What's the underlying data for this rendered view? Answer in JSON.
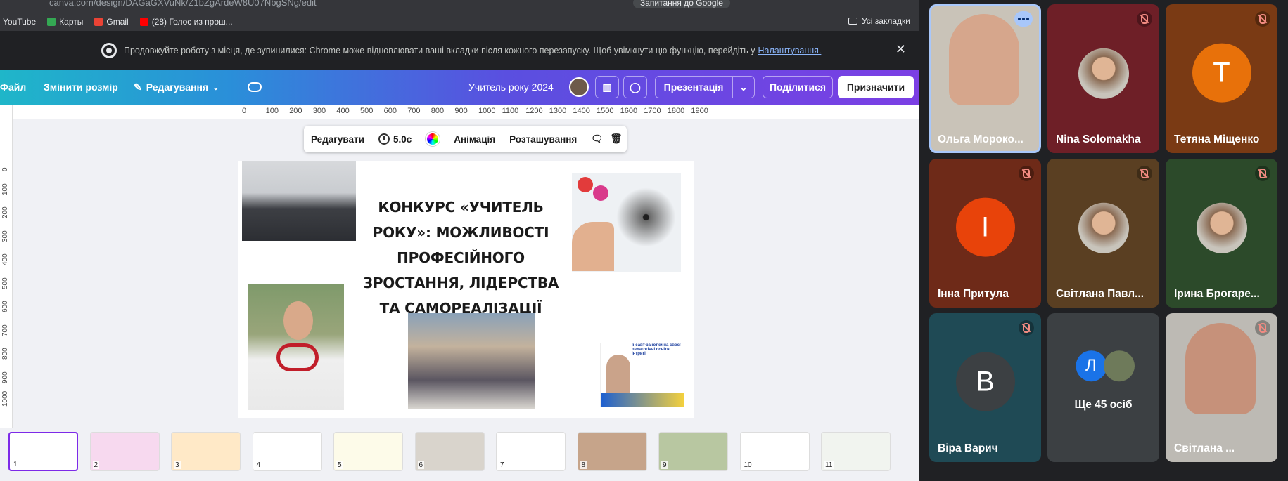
{
  "browser": {
    "url": "canva.com/design/DAGaGXVuNk/Z1bZgArdeW8U07NbgSNg/edit",
    "google_translate": "Запитання до Google",
    "bookmarks": [
      {
        "label": "YouTube",
        "color": "#ff0000"
      },
      {
        "label": "Карты",
        "color": "#34a853"
      },
      {
        "label": "Gmail",
        "color": "#ea4335"
      },
      {
        "label": "(28) Голос из прош...",
        "color": "#ff0000"
      }
    ],
    "all_bookmarks": "Усі закладки",
    "notice_text": "Продовжуйте роботу з місця, де зупинилися: Chrome може відновлювати ваші вкладки після кожного перезапуску. Щоб увімкнути цю функцію, перейдіть у",
    "notice_link": "Налаштування."
  },
  "canva": {
    "file": "Файл",
    "resize": "Змінити розмір",
    "editing": "Редагування",
    "doc_title": "Учитель року 2024",
    "present": "Презентація",
    "share": "Поділитися",
    "assign": "Призначити",
    "ruler_ticks": [
      "0",
      "100",
      "200",
      "300",
      "400",
      "500",
      "600",
      "700",
      "800",
      "900",
      "1000",
      "1100",
      "1200",
      "1300",
      "1400",
      "1500",
      "1600",
      "1700",
      "1800",
      "1900"
    ],
    "vruler_ticks": [
      "0",
      "100",
      "200",
      "300",
      "400",
      "500",
      "600",
      "700",
      "800",
      "900",
      "1000"
    ],
    "floating_toolbar": {
      "edit": "Редагувати",
      "duration": "5.0с",
      "animation": "Анімація",
      "position": "Розташування"
    },
    "slide": {
      "title": "КОНКУРС «УЧИТЕЛЬ РОКУ»: МОЖЛИВОСТІ ПРОФЕСІЙНОГО ЗРОСТАННЯ, ЛІДЕРСТВА ТА САМОРЕАЛІЗАЦІЇ ПЕДАГОГА",
      "infographic_title": "Інсайт-занотки на своєї педагогічні освітні інтригі"
    },
    "thumbnails": [
      "1",
      "2",
      "3",
      "4",
      "5",
      "6",
      "7",
      "8",
      "9",
      "10",
      "11"
    ]
  },
  "meet": {
    "participants": [
      {
        "name": "Ольга Мороко...",
        "bg": "#c9c3b8",
        "initial": "",
        "type": "video",
        "speaking": true
      },
      {
        "name": "Nina Solomakha",
        "bg": "#6e1f27",
        "initial": "",
        "type": "photo",
        "muted": true
      },
      {
        "name": "Тетяна Міщенко",
        "bg": "#7a3a14",
        "initial": "Т",
        "avatar_color": "#e8710a",
        "type": "letter",
        "muted": true
      },
      {
        "name": "Інна Притула",
        "bg": "#6e2a18",
        "initial": "І",
        "avatar_color": "#e8430a",
        "type": "letter",
        "muted": true
      },
      {
        "name": "Світлана Павл...",
        "bg": "#5a3f22",
        "initial": "",
        "type": "photo",
        "muted": true
      },
      {
        "name": "Ірина Брогаре...",
        "bg": "#2c4a2a",
        "initial": "",
        "type": "photo",
        "muted": true
      },
      {
        "name": "Віра Варич",
        "bg": "#1f4a55",
        "initial": "В",
        "avatar_color": "#3c4043",
        "type": "letter",
        "muted": true
      },
      {
        "name": "Ще 45 осіб",
        "bg": "#3c4043",
        "initial": "Л",
        "avatar_color": "#1a73e8",
        "type": "more"
      },
      {
        "name": "Світлана ...",
        "bg": "#bdbab4",
        "initial": "",
        "type": "video",
        "muted": true
      }
    ]
  },
  "colors": {
    "canva_purple": "#7d2ae8",
    "meet_bg": "#202124"
  }
}
